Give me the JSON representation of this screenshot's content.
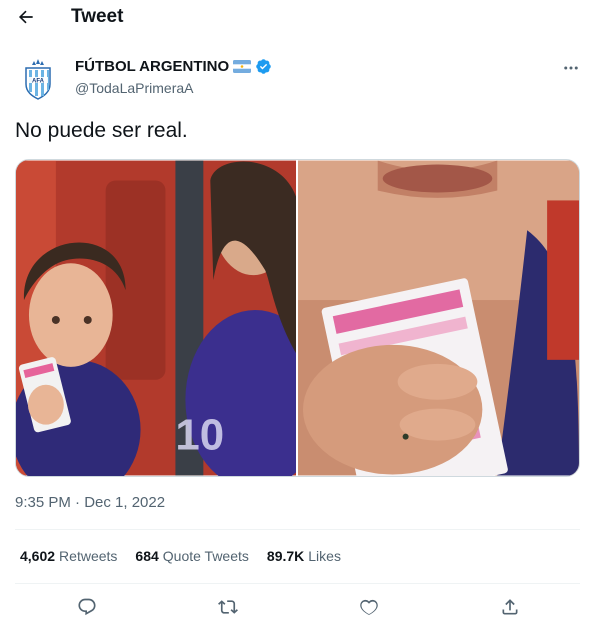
{
  "header": {
    "title": "Tweet",
    "back_icon": "arrow-left-icon"
  },
  "author": {
    "name": "FÚTBOL ARGENTINO",
    "flag_icon": "argentina-flag-icon",
    "verified_icon": "verified-badge-icon",
    "handle": "@TodaLaPrimeraA",
    "more_icon": "more-horizontal-icon"
  },
  "tweet": {
    "text": "No puede ser real.",
    "timestamp": "9:35 PM · Dec 1, 2022"
  },
  "stats": [
    {
      "count": "4,602",
      "label": "Retweets"
    },
    {
      "count": "684",
      "label": "Quote Tweets"
    },
    {
      "count": "89.7K",
      "label": "Likes"
    }
  ],
  "actions": {
    "reply_icon": "reply-icon",
    "retweet_icon": "retweet-icon",
    "like_icon": "heart-icon",
    "share_icon": "share-icon"
  },
  "colors": {
    "text_primary": "#0f1419",
    "text_secondary": "#536471",
    "verified": "#1d9bf0",
    "divider": "#eff3f4"
  }
}
